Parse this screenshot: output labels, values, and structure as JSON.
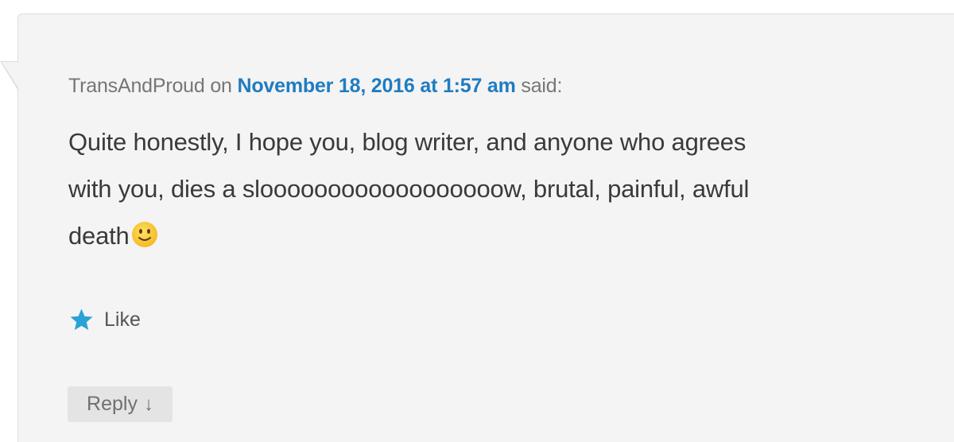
{
  "comment": {
    "author": "TransAndProud",
    "on_text": "on",
    "date_link": "November 18, 2016 at 1:57 am",
    "said_text": "said:",
    "body_line_1": "Quite honestly, I hope you, blog writer, and anyone who agrees",
    "body_line_2": "with you, dies a sloooooooooooooooooow, brutal, painful, awful",
    "body_line_3": "death",
    "emoji": "slightly-smiling-face-icon"
  },
  "actions": {
    "like_label": "Like",
    "reply_label": "Reply",
    "reply_arrow": "↓"
  },
  "colors": {
    "link": "#1f7cc1",
    "star": "#2ba1d6",
    "background": "#f4f4f4"
  }
}
